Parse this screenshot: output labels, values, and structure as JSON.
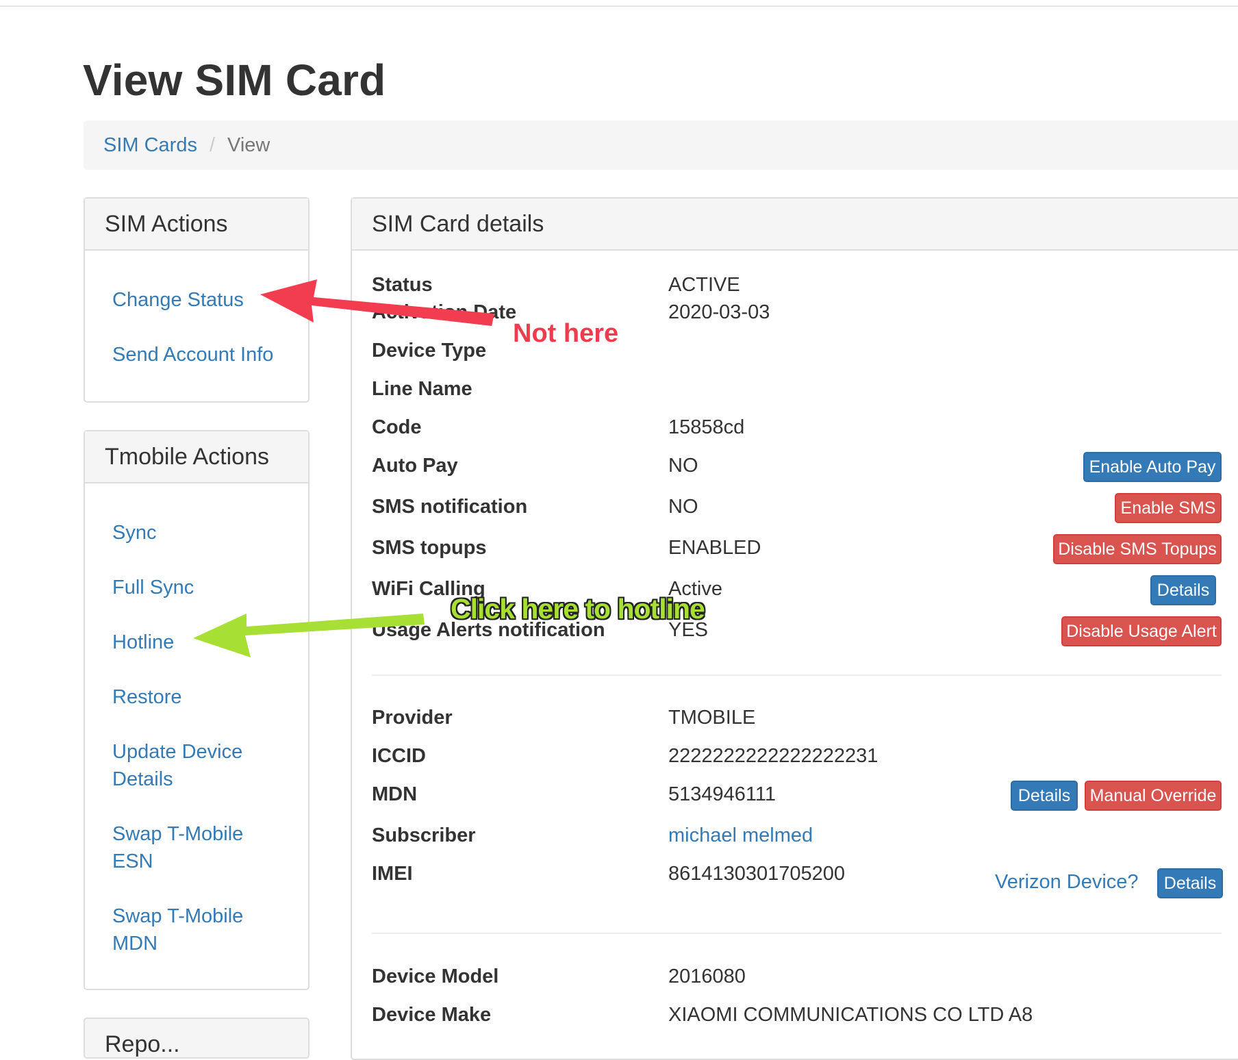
{
  "page": {
    "title": "View SIM Card"
  },
  "breadcrumb": {
    "items": [
      "SIM Cards",
      "View"
    ]
  },
  "sim_actions": {
    "heading": "SIM Actions",
    "links": [
      "Change Status",
      "Send Account Info"
    ]
  },
  "tmobile_actions": {
    "heading": "Tmobile Actions",
    "links": [
      "Sync",
      "Full Sync",
      "Hotline",
      "Restore",
      "Update Device Details",
      "Swap T-Mobile ESN",
      "Swap T-Mobile MDN"
    ]
  },
  "next_panel": {
    "heading": "Repo..."
  },
  "details": {
    "heading": "SIM Card details",
    "rows": [
      {
        "label": "Status",
        "value": "ACTIVE"
      },
      {
        "label": "Activation Date",
        "value": "2020-03-03"
      },
      {
        "label": "Device Type",
        "value": ""
      },
      {
        "label": "Line Name",
        "value": ""
      },
      {
        "label": "Code",
        "value": "15858cd"
      },
      {
        "label": "Auto Pay",
        "value": "NO"
      },
      {
        "label": "SMS notification",
        "value": "NO"
      },
      {
        "label": "SMS topups",
        "value": "ENABLED"
      },
      {
        "label": "WiFi Calling",
        "value": "Active"
      },
      {
        "label": "Usage Alerts notification",
        "value": "YES"
      },
      {
        "label": "Provider",
        "value": "TMOBILE"
      },
      {
        "label": "ICCID",
        "value": "2222222222222222231"
      },
      {
        "label": "MDN",
        "value": "5134946111"
      },
      {
        "label": "Subscriber",
        "value": "michael melmed"
      },
      {
        "label": "IMEI",
        "value": "8614130301705200"
      },
      {
        "label": "Device Model",
        "value": "2016080"
      },
      {
        "label": "Device Make",
        "value": "XIAOMI COMMUNICATIONS CO LTD A8"
      }
    ],
    "buttons": {
      "enable_auto_pay": "Enable Auto Pay",
      "enable_sms": "Enable SMS",
      "disable_sms_topups": "Disable SMS Topups",
      "wifi_details": "Details",
      "disable_usage_alert": "Disable Usage Alert",
      "mdn_details": "Details",
      "manual_override": "Manual Override",
      "verizon_device": "Verizon Device?",
      "imei_details": "Details"
    }
  },
  "annotations": {
    "not_here": "Not here",
    "click_here": "Click here to hotline"
  },
  "colors": {
    "link": "#337ab7",
    "btn_primary": "#337ab7",
    "btn_danger": "#d9534f",
    "arrow_red": "#f23c4f",
    "arrow_green": "#a7df35"
  }
}
